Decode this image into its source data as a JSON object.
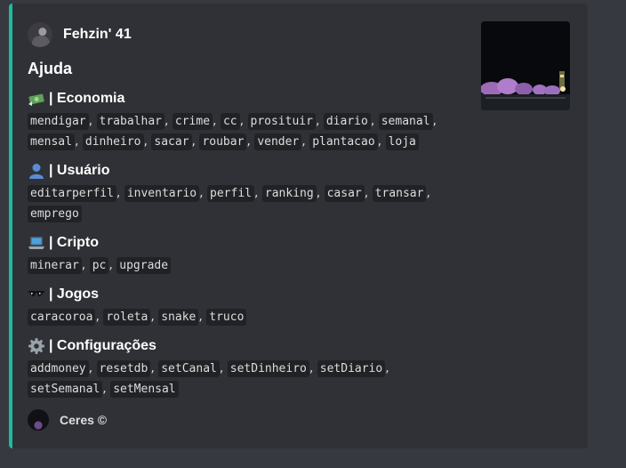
{
  "embed": {
    "accent_color": "#1abc9c",
    "author": {
      "name": "Fehzin' 41"
    },
    "title": "Ajuda",
    "fields": [
      {
        "icon": "money-icon",
        "name": "| Economia",
        "commands": [
          "mendigar",
          "trabalhar",
          "crime",
          "cc",
          "prosituir",
          "diario",
          "semanal",
          "mensal",
          "dinheiro",
          "sacar",
          "roubar",
          "vender",
          "plantacao",
          "loja"
        ]
      },
      {
        "icon": "user-icon",
        "name": "| Usuário",
        "commands": [
          "editarperfil",
          "inventario",
          "perfil",
          "ranking",
          "casar",
          "transar",
          "emprego"
        ]
      },
      {
        "icon": "laptop-icon",
        "name": "| Cripto",
        "commands": [
          "minerar",
          "pc",
          "upgrade"
        ]
      },
      {
        "icon": "sunglasses-icon",
        "name": "| Jogos",
        "commands": [
          "caracoroa",
          "roleta",
          "snake",
          "truco"
        ]
      },
      {
        "icon": "gear-icon",
        "name": "| Configurações",
        "commands": [
          "addmoney",
          "resetdb",
          "setCanal",
          "setDinheiro",
          "setDiario",
          "setSemanal",
          "setMensal"
        ]
      }
    ],
    "footer": {
      "text": "Ceres ©"
    }
  }
}
